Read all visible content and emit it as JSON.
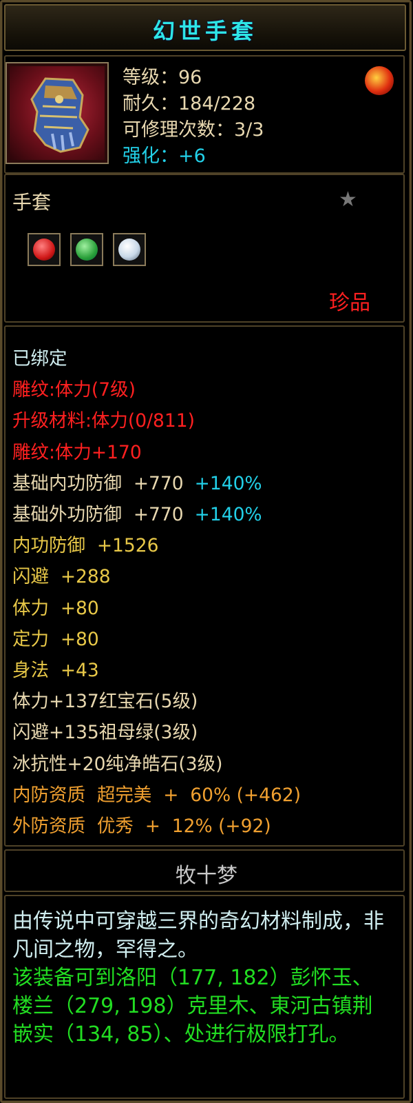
{
  "item": {
    "name": "幻世手套",
    "level_label": "等级：",
    "level": "96",
    "durability_label": "耐久：",
    "durability": "184/228",
    "repair_label": "可修理次数：",
    "repair": "3/3",
    "enhance_label": "强化：",
    "enhance": "+6",
    "type": "手套",
    "rarity": "珍品",
    "icon": "gauntlet-icon",
    "badge_icon": "fire-orb-icon",
    "favorite_icon": "star-icon"
  },
  "sockets": [
    {
      "name": "ruby-gem-icon",
      "color": "#d01818"
    },
    {
      "name": "emerald-gem-icon",
      "color": "#2aa03a"
    },
    {
      "name": "diamond-gem-icon",
      "color": "#c8d8e8"
    }
  ],
  "attributes": [
    {
      "text": "已绑定",
      "color": "white"
    },
    {
      "text": "雕纹:体力(7级)",
      "color": "red"
    },
    {
      "text": "升级材料:体力(0/811)",
      "color": "red"
    },
    {
      "text": "雕纹:体力+170",
      "color": "red"
    },
    {
      "text": "基础内功防御  +770",
      "extra": "+140%",
      "color": "tan"
    },
    {
      "text": "基础外功防御  +770",
      "extra": "+140%",
      "color": "tan"
    },
    {
      "text": "内功防御  +1526",
      "color": "yellow"
    },
    {
      "text": "闪避  +288",
      "color": "yellow"
    },
    {
      "text": "体力  +80",
      "color": "yellow"
    },
    {
      "text": "定力  +80",
      "color": "yellow"
    },
    {
      "text": "身法  +43",
      "color": "yellow"
    },
    {
      "text": "体力+137红宝石(5级)",
      "color": "tan"
    },
    {
      "text": "闪避+135祖母绿(3级)",
      "color": "tan"
    },
    {
      "text": "冰抗性+20纯净皓石(3级)",
      "color": "tan"
    },
    {
      "text": "内防资质  超完美  +  60% (+462)",
      "color": "orange"
    },
    {
      "text": "外防资质  优秀  +  12% (+92)",
      "color": "orange"
    }
  ],
  "maker": "牧十梦",
  "description": {
    "lore": "由传说中可穿越三界的奇幻材料制成，非凡间之物，罕得之。",
    "hint": "该装备可到洛阳（177, 182）彭怀玉、楼兰（279, 198）克里木、東河古镇荆嵌实（134, 85）、处进行极限打孔。"
  }
}
